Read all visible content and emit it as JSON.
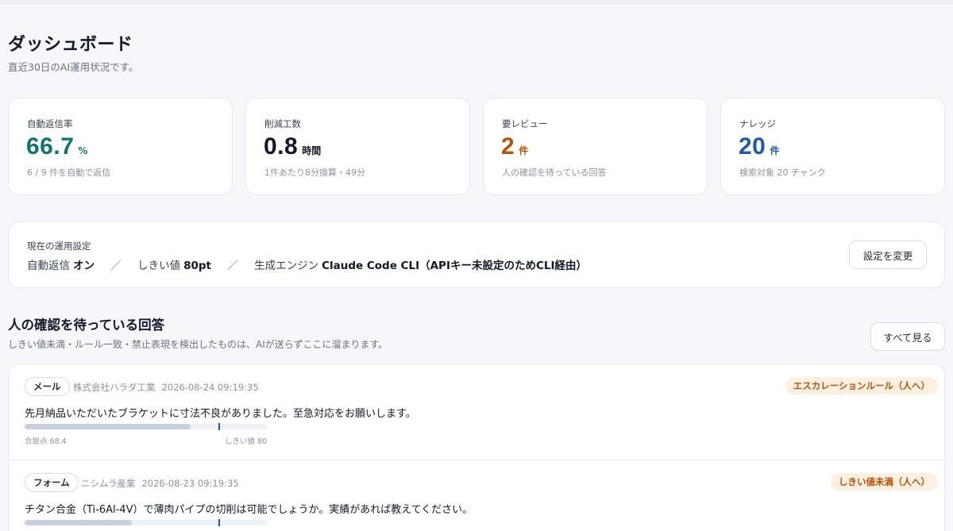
{
  "header": {
    "title": "ダッシュボード",
    "subtitle": "直近30日のAI運用状況です。"
  },
  "kpis": [
    {
      "label": "自動返信率",
      "value": "66.7",
      "unit": "%",
      "note": "6 / 9 件を自動で返信",
      "color": "#0f766e"
    },
    {
      "label": "削減工数",
      "value": "0.8",
      "unit": "時間",
      "note": "1件あたり8分換算・49分",
      "color": "#111827"
    },
    {
      "label": "要レビュー",
      "value": "2",
      "unit": "件",
      "note": "人の確認を待っている回答",
      "color": "#b45309"
    },
    {
      "label": "ナレッジ",
      "value": "20",
      "unit": "件",
      "note": "検索対象 20 チャンク",
      "color": "#1e5aa8"
    }
  ],
  "settings": {
    "label": "現在の運用設定",
    "auto_reply_label": "自動返信",
    "auto_reply_value": "オン",
    "threshold_label": "しきい値",
    "threshold_value": "80pt",
    "engine_label": "生成エンジン",
    "engine_value": "Claude Code CLI（APIキー未設定のためCLI経由）",
    "separator": "／",
    "change_button": "設定を変更"
  },
  "pending": {
    "title": "人の確認を待っている回答",
    "subtitle": "しきい値未満・ルール一致・禁止表現を検出したものは、AIが送らずここに溜まります。",
    "view_all_button": "すべて見る",
    "items": [
      {
        "channel": "メール",
        "company": "株式会社ハラダ工業",
        "datetime": "2026-08-24 09:19:35",
        "reason": "エスカレーションルール（人へ）",
        "message": "先月納品いただいたブラケットに寸法不良がありました。至急対応をお願いします。",
        "score_label": "合致点 68.4",
        "score": 68.4,
        "threshold_label": "しきい値 80",
        "threshold": 80
      },
      {
        "channel": "フォーム",
        "company": "ニシムラ産業",
        "datetime": "2026-08-23 09:19:35",
        "reason": "しきい値未満（人へ）",
        "message": "チタン合金（Ti-6Al-4V）で薄肉パイプの切削は可能でしょうか。実績があれば教えてください。",
        "score_label": "",
        "score": 44,
        "threshold_label": "",
        "threshold": 80
      }
    ]
  }
}
